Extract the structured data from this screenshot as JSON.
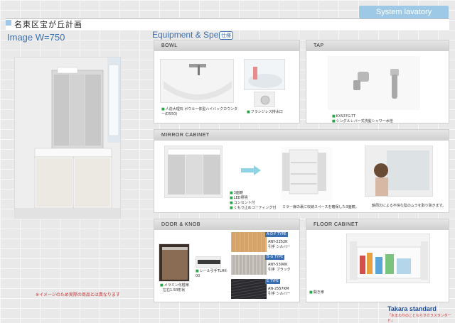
{
  "header": {
    "banner": "System lavatory",
    "title": "名東区宝が丘計画",
    "image_label": "Image  W=750",
    "equip_title": "Equipment & Spec",
    "equip_badge": "仕様"
  },
  "disclaimer": "※イメージのため実際の商品とは異なります",
  "panels": {
    "bowl": {
      "title": "BOWL",
      "caption1": "人造大理石 ボウル一体型ハイバックカウンター(D550)",
      "caption2": "フランジレス排水口"
    },
    "tap": {
      "title": "TAP",
      "caption1": "KXS37G-TT",
      "caption2": "シングルレバー式洗髪シャワー水栓"
    },
    "mirror": {
      "title": "MIRROR CABINET",
      "caption1": "3面鏡",
      "caption2": "LED照明",
      "caption3": "コンセント付",
      "caption4": "くもり止めコーティング付",
      "caption5": "ミラー扉の裏に収納スペースを確保した3面鏡。",
      "caption6": "鏡周辺による不快な陰のムラを取り除きます。"
    },
    "door": {
      "title": "DOOR & KNOB",
      "caption1": "メラミン化粧扉",
      "caption1b": "左右1.5R形状",
      "caption2": "レール引手TLHK-00",
      "swatches": [
        {
          "tag": "A-D-F TYPE",
          "code": "ANY-2252K",
          "knob": "引手 シルバー",
          "color": "#d5a46a"
        },
        {
          "tag": "B-G TYPE",
          "code": "ANY-5390K",
          "knob": "引手 ブラック",
          "color": "#b9b4ad"
        },
        {
          "tag": "E TYPE",
          "code": "AN-2557KM",
          "knob": "引手 シルバー",
          "color": "#2b2b2f"
        }
      ]
    },
    "floor": {
      "title": "FLOOR CABINET",
      "caption1": "開き扉"
    }
  },
  "footer": {
    "logo": "Takara standard",
    "logo_sub": "「水まわりのことならタカラスタンダード」"
  }
}
